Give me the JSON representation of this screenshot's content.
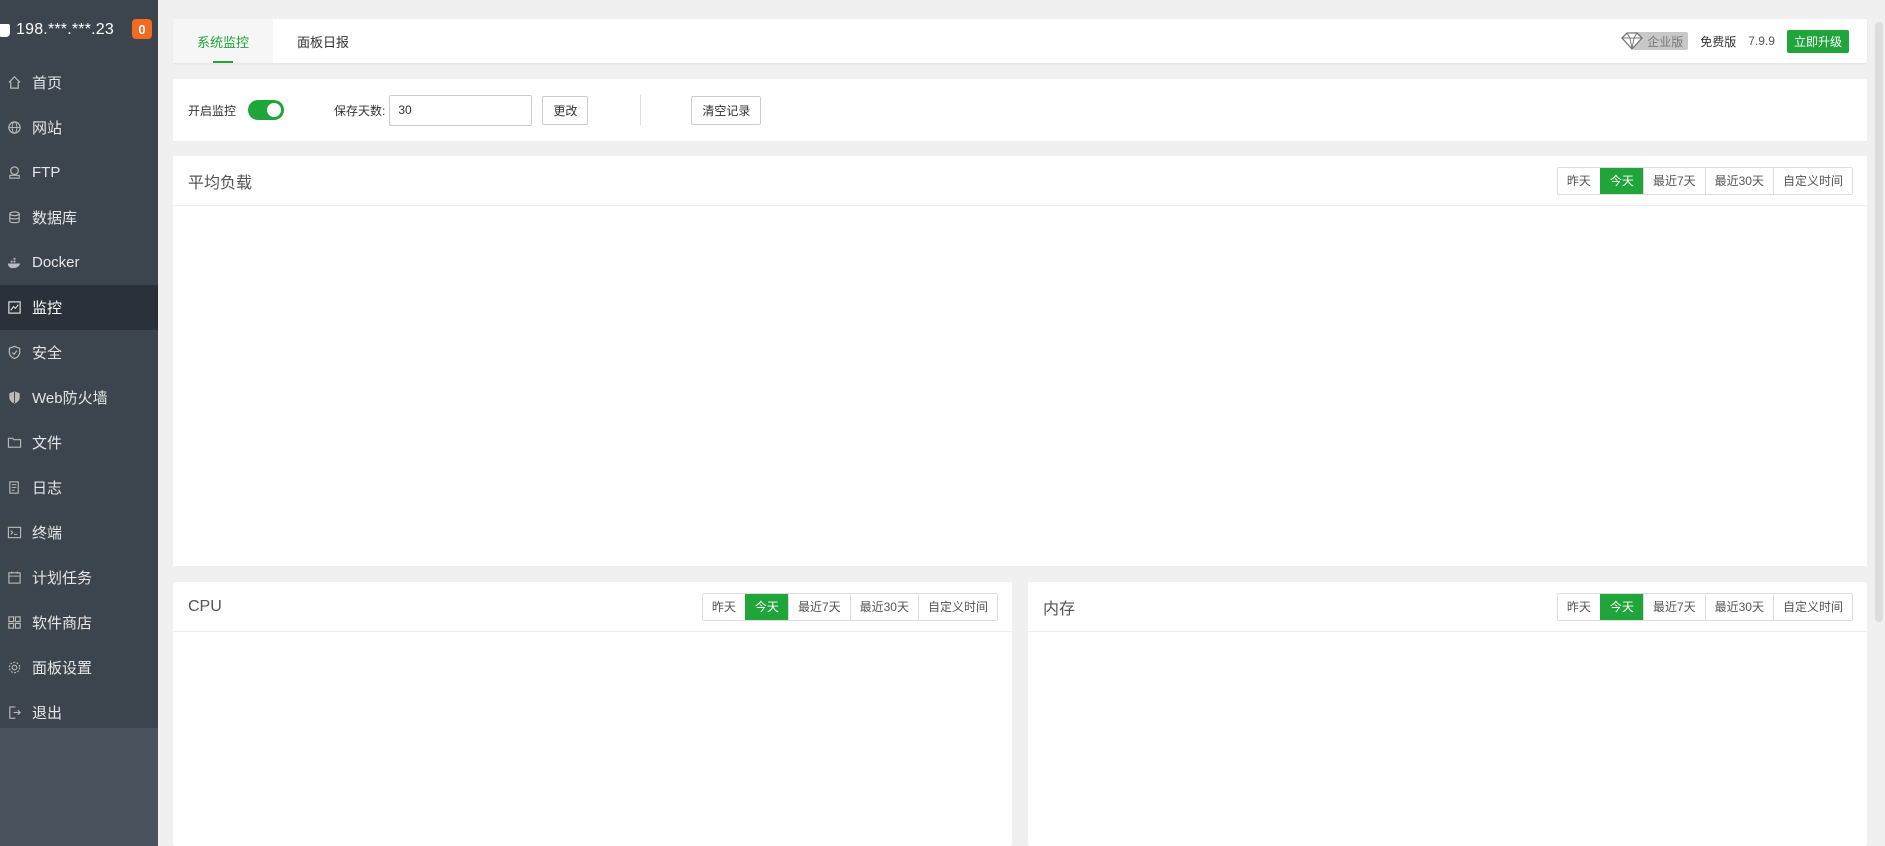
{
  "sidebar": {
    "server_ip": "198.***.***.23",
    "badge_count": "0",
    "items": [
      {
        "label": "首页",
        "icon": "home-icon"
      },
      {
        "label": "网站",
        "icon": "globe-icon"
      },
      {
        "label": "FTP",
        "icon": "ftp-icon"
      },
      {
        "label": "数据库",
        "icon": "database-icon"
      },
      {
        "label": "Docker",
        "icon": "docker-icon"
      },
      {
        "label": "监控",
        "icon": "monitor-icon",
        "active": true
      },
      {
        "label": "安全",
        "icon": "shield-icon"
      },
      {
        "label": "Web防火墙",
        "icon": "firewall-icon"
      },
      {
        "label": "文件",
        "icon": "folder-icon"
      },
      {
        "label": "日志",
        "icon": "log-icon"
      },
      {
        "label": "终端",
        "icon": "terminal-icon"
      },
      {
        "label": "计划任务",
        "icon": "calendar-icon"
      },
      {
        "label": "软件商店",
        "icon": "apps-icon"
      },
      {
        "label": "面板设置",
        "icon": "gear-icon"
      },
      {
        "label": "退出",
        "icon": "logout-icon"
      }
    ]
  },
  "topbar": {
    "tabs": [
      {
        "label": "系统监控",
        "active": true
      },
      {
        "label": "面板日报",
        "active": false
      }
    ],
    "enterprise_label": "企业版",
    "edition_label": "免费版",
    "version": "7.9.9",
    "upgrade_label": "立即升级"
  },
  "controls": {
    "monitor_label": "开启监控",
    "monitor_enabled": true,
    "days_label": "保存天数:",
    "days_value": "30",
    "change_label": "更改",
    "clear_label": "清空记录"
  },
  "range_options": [
    "昨天",
    "今天",
    "最近7天",
    "最近30天",
    "自定义时间"
  ],
  "active_range": "今天",
  "panels": {
    "load": {
      "title": "平均负载"
    },
    "cpu": {
      "title": "CPU"
    },
    "memory": {
      "title": "内存"
    }
  },
  "colors": {
    "accent": "#20a53a",
    "sidebar_bg": "#3c444d",
    "badge": "#f26b21"
  }
}
